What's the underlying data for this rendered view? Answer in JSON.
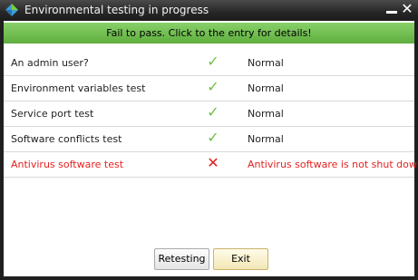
{
  "window": {
    "title": "Environmental testing in progress",
    "icons": {
      "app": "app-logo-icon",
      "minimize": "minimize-icon",
      "close": "close-icon"
    },
    "close_glyph": "✕"
  },
  "banner": {
    "text": "Fail to pass. Click to the entry for details!",
    "color": "#6fbf4f"
  },
  "tests": [
    {
      "name": "An admin user?",
      "result": "pass",
      "mark": "✓",
      "status": "Normal"
    },
    {
      "name": "Environment variables test",
      "result": "pass",
      "mark": "✓",
      "status": "Normal"
    },
    {
      "name": "Service port test",
      "result": "pass",
      "mark": "✓",
      "status": "Normal"
    },
    {
      "name": "Software conflicts test",
      "result": "pass",
      "mark": "✓",
      "status": "Normal"
    },
    {
      "name": "Antivirus software test",
      "result": "fail",
      "mark": "✕",
      "status": "Antivirus software is not shut down"
    }
  ],
  "buttons": {
    "retest_label": "Retesting",
    "exit_label": "Exit"
  },
  "colors": {
    "pass": "#6cc04a",
    "fail": "#e3211f",
    "titlebar": "#262626"
  }
}
